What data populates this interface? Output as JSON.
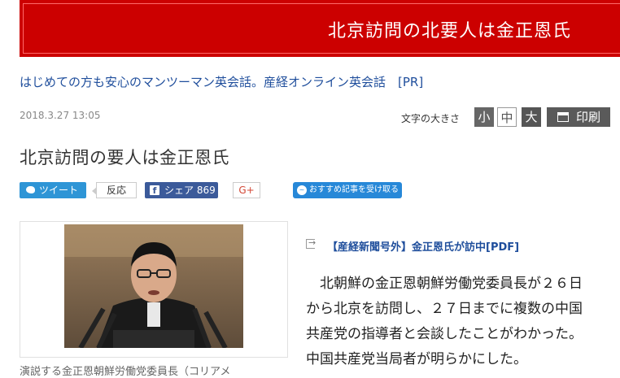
{
  "banner": {
    "title": "北京訪問の北要人は金正恩氏"
  },
  "ad": {
    "text": "はじめての方も安心のマンツーマン英会話。産経オンライン英会話　[PR]"
  },
  "meta": {
    "date": "2018.3.27 13:05",
    "size_label": "文字の大きさ",
    "size_small": "小",
    "size_mid": "中",
    "size_large": "大",
    "print": "印刷"
  },
  "article": {
    "headline": "北京訪問の要人は金正恩氏",
    "pdf_link": "【産経新聞号外】金正恩氏が訪中[PDF]",
    "body": [
      "　北朝鮮の金正恩朝鮮労働党委員長が２６日",
      "から北京を訪問し、２７日までに複数の中国",
      "共産党の指導者と会談したことがわかった。",
      "中国共産党当局者が明らかにした。"
    ],
    "caption": "演説する金正恩朝鮮労働党委員長（コリアメ"
  },
  "social": {
    "tweet": "ツイート",
    "reaction": "反応",
    "share": "シェア 869",
    "gplus": "G+",
    "recommend": "おすすめ記事を受け取る"
  },
  "colors": {
    "banner": "#cc0000",
    "link": "#1f4e9c",
    "twitter": "#2e95d6",
    "facebook": "#3b5a9a"
  }
}
